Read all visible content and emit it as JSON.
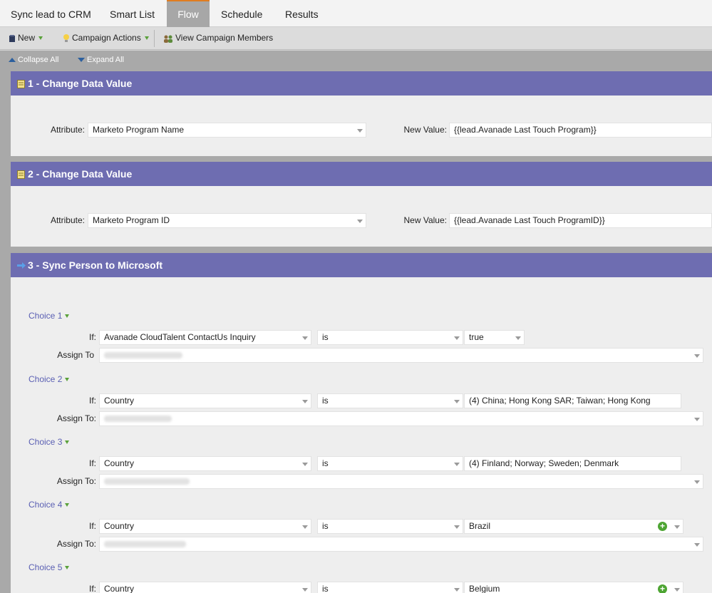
{
  "tabs": [
    {
      "label": "Sync lead to CRM"
    },
    {
      "label": "Smart List"
    },
    {
      "label": "Flow"
    },
    {
      "label": "Schedule"
    },
    {
      "label": "Results"
    }
  ],
  "toolbar": {
    "new_label": "New",
    "campaign_actions_label": "Campaign Actions",
    "view_members_label": "View Campaign Members"
  },
  "controls": {
    "collapse_all": "Collapse All",
    "expand_all": "Expand All"
  },
  "steps": [
    {
      "title": "1 - Change Data Value",
      "attribute_label": "Attribute:",
      "attribute_value": "Marketo Program Name",
      "new_value_label": "New Value:",
      "new_value": "{{lead.Avanade Last Touch Program}}"
    },
    {
      "title": "2 - Change Data Value",
      "attribute_label": "Attribute:",
      "attribute_value": "Marketo Program ID",
      "new_value_label": "New Value:",
      "new_value": "{{lead.Avanade Last Touch ProgramID}}"
    },
    {
      "title": "3 - Sync Person to Microsoft",
      "choices": [
        {
          "label": "Choice 1",
          "if_label": "If:",
          "field": "Avanade CloudTalent ContactUs Inquiry",
          "operator": "is",
          "value": "true",
          "assign_label": "Assign To"
        },
        {
          "label": "Choice 2",
          "if_label": "If:",
          "field": "Country",
          "operator": "is",
          "value": "(4) China; Hong Kong SAR; Taiwan; Hong Kong",
          "assign_label": "Assign To:"
        },
        {
          "label": "Choice 3",
          "if_label": "If:",
          "field": "Country",
          "operator": "is",
          "value": "(4) Finland; Norway; Sweden; Denmark",
          "assign_label": "Assign To:"
        },
        {
          "label": "Choice 4",
          "if_label": "If:",
          "field": "Country",
          "operator": "is",
          "value": "Brazil",
          "assign_label": "Assign To:"
        },
        {
          "label": "Choice 5",
          "if_label": "If:",
          "field": "Country",
          "operator": "is",
          "value": "Belgium"
        }
      ]
    }
  ],
  "colors": {
    "step_header": "#6e6db1",
    "active_tab": "#a7a7a7",
    "active_tab_accent": "#e07c20",
    "choice_link": "#5a5fb3",
    "add_button": "#4ea533"
  }
}
